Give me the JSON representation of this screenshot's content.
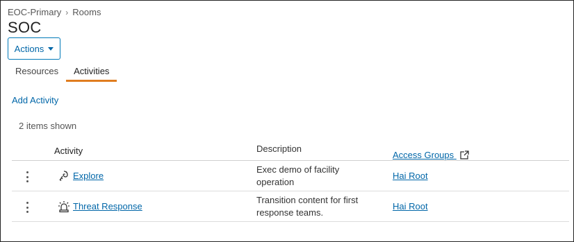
{
  "breadcrumb": {
    "parent": "EOC-Primary",
    "separator": "›",
    "current": "Rooms"
  },
  "page": {
    "title": "SOC"
  },
  "actions": {
    "label": "Actions"
  },
  "tabs": [
    {
      "label": "Resources",
      "active": false
    },
    {
      "label": "Activities",
      "active": true
    }
  ],
  "add_activity": {
    "label": "Add Activity"
  },
  "items_shown": "2 items shown",
  "table": {
    "columns": [
      "Activity",
      "Description",
      "Access Groups"
    ],
    "rows": [
      {
        "icon": "explore-icon",
        "activity": "Explore",
        "description": "Exec demo of facility operation",
        "access_group": "Hai Root"
      },
      {
        "icon": "alarm-light-icon",
        "activity": "Threat Response",
        "description": "Transition content for first response teams.",
        "access_group": "Hai Root"
      }
    ]
  },
  "colors": {
    "link": "#0066a8",
    "tab_active_underline": "#e07d1f",
    "border": "#dcdcdc"
  }
}
